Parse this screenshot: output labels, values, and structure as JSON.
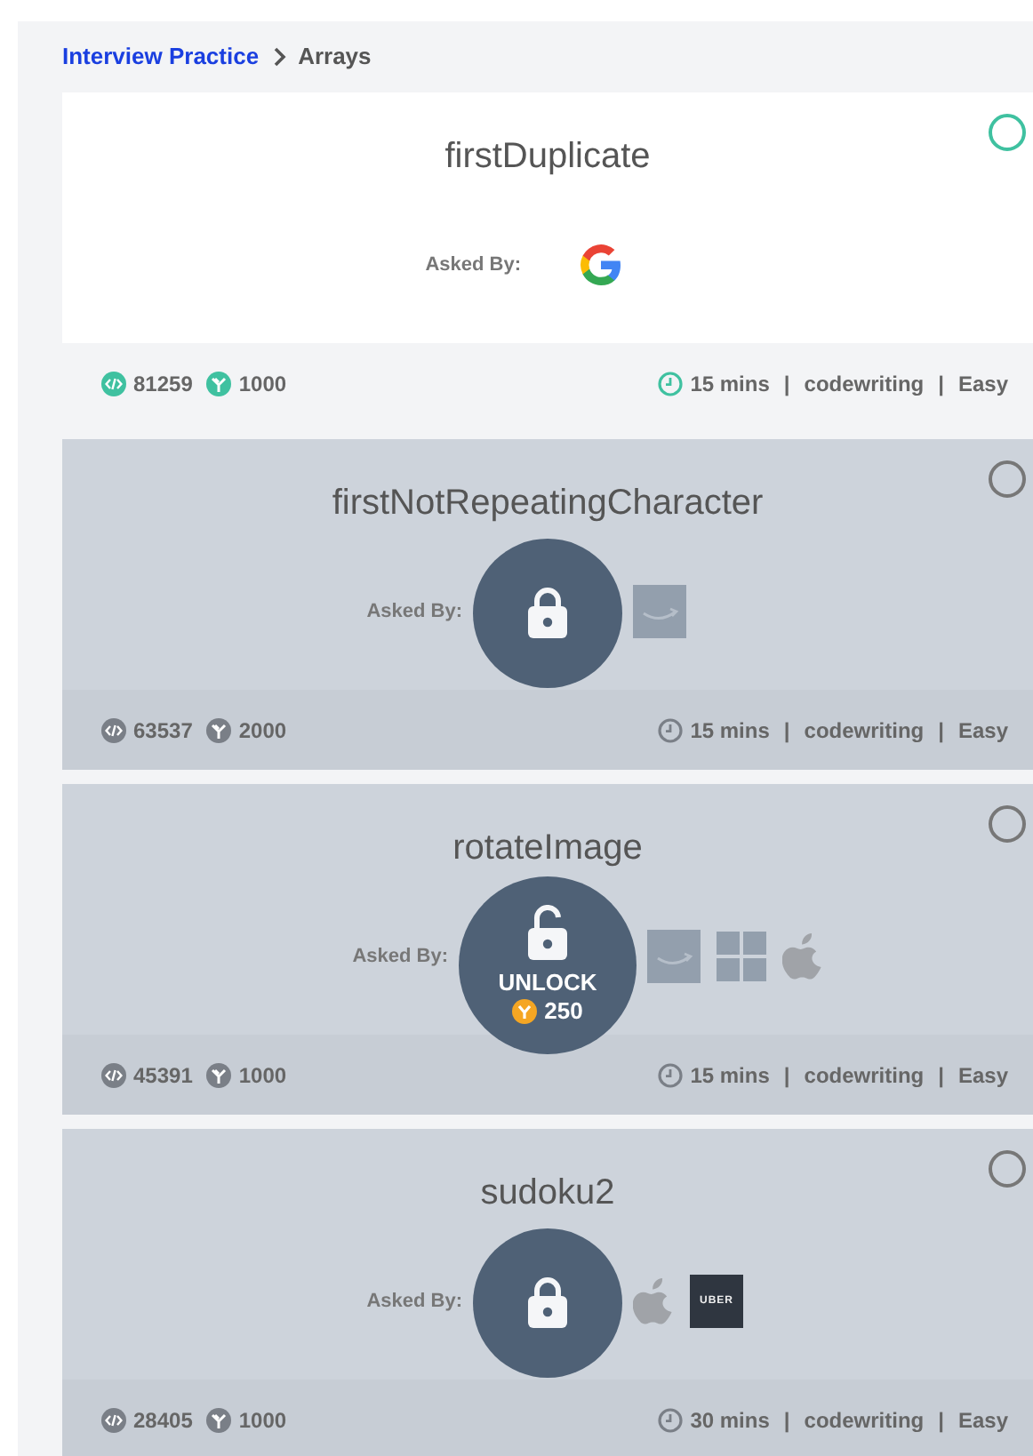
{
  "breadcrumb": {
    "parent": "Interview Practice",
    "current": "Arrays"
  },
  "cards": [
    {
      "title": "firstDuplicate",
      "solved": false,
      "locked": false,
      "asked_by_label": "Asked By:",
      "companies": [
        {
          "kind": "google"
        }
      ],
      "stats": [
        {
          "kind": "submissions",
          "text": "81259"
        },
        {
          "kind": "reward",
          "text": "1000"
        }
      ],
      "meta": [
        {
          "kind": "time",
          "text": "15 mins"
        },
        {
          "kind": "separator",
          "text": "|"
        },
        {
          "kind": "plain",
          "text": "codewriting"
        },
        {
          "kind": "separator",
          "text": "|"
        },
        {
          "kind": "plain",
          "text": "Easy"
        }
      ]
    },
    {
      "title": "firstNotRepeatingCharacter",
      "solved": false,
      "locked": true,
      "asked_by_label": "Asked By:",
      "companies": [
        {
          "kind": "amazon"
        }
      ],
      "stats": [
        {
          "kind": "submissions",
          "text": "63537"
        },
        {
          "kind": "reward",
          "text": "2000"
        }
      ],
      "meta": [
        {
          "kind": "time",
          "text": "15 mins"
        },
        {
          "kind": "separator",
          "text": "|"
        },
        {
          "kind": "plain",
          "text": "codewriting"
        },
        {
          "kind": "separator",
          "text": "|"
        },
        {
          "kind": "plain",
          "text": "Easy"
        }
      ]
    },
    {
      "title": "rotateImage",
      "solved": false,
      "locked": true,
      "unlock_label": "UNLOCK",
      "unlock_cost": "250",
      "asked_by_label": "Asked By:",
      "companies": [
        {
          "kind": "amazon"
        },
        {
          "kind": "microsoft"
        },
        {
          "kind": "apple"
        }
      ],
      "stats": [
        {
          "kind": "submissions",
          "text": "45391"
        },
        {
          "kind": "reward",
          "text": "1000"
        }
      ],
      "meta": [
        {
          "kind": "time",
          "text": "15 mins"
        },
        {
          "kind": "separator",
          "text": "|"
        },
        {
          "kind": "plain",
          "text": "codewriting"
        },
        {
          "kind": "separator",
          "text": "|"
        },
        {
          "kind": "plain",
          "text": "Easy"
        }
      ]
    },
    {
      "title": "sudoku2",
      "solved": false,
      "locked": true,
      "asked_by_label": "Asked By:",
      "companies": [
        {
          "kind": "apple"
        },
        {
          "kind": "uber",
          "text": "UBER"
        }
      ],
      "stats": [
        {
          "kind": "submissions",
          "text": "28405"
        },
        {
          "kind": "reward",
          "text": "1000"
        }
      ],
      "meta": [
        {
          "kind": "time",
          "text": "30 mins"
        },
        {
          "kind": "separator",
          "text": "|"
        },
        {
          "kind": "plain",
          "text": "codewriting"
        },
        {
          "kind": "separator",
          "text": "|"
        },
        {
          "kind": "plain",
          "text": "Easy"
        }
      ]
    }
  ]
}
